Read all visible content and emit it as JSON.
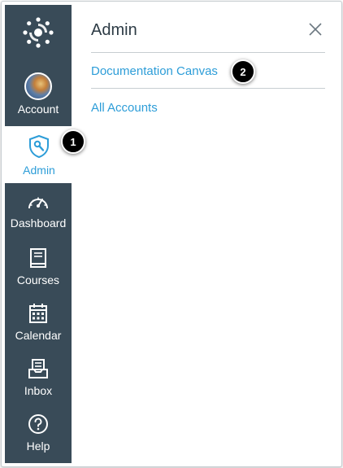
{
  "colors": {
    "nav_bg": "#394b58",
    "accent": "#2d9dd8",
    "text_dark": "#2d3b45",
    "divider": "#c7cdd1"
  },
  "global_nav": {
    "logo_icon": "canvas-logo-icon",
    "items": [
      {
        "label": "Account",
        "icon": "avatar",
        "active": false
      },
      {
        "label": "Admin",
        "icon": "shield-wrench-icon",
        "active": true
      },
      {
        "label": "Dashboard",
        "icon": "speedometer-icon",
        "active": false
      },
      {
        "label": "Courses",
        "icon": "book-icon",
        "active": false
      },
      {
        "label": "Calendar",
        "icon": "calendar-icon",
        "active": false
      },
      {
        "label": "Inbox",
        "icon": "inbox-icon",
        "active": false
      },
      {
        "label": "Help",
        "icon": "question-circle-icon",
        "active": false
      }
    ]
  },
  "tray": {
    "title": "Admin",
    "close_icon": "close-icon",
    "links": [
      {
        "label": "Documentation Canvas"
      },
      {
        "label": "All Accounts"
      }
    ]
  },
  "callouts": [
    {
      "number": "1"
    },
    {
      "number": "2"
    }
  ]
}
